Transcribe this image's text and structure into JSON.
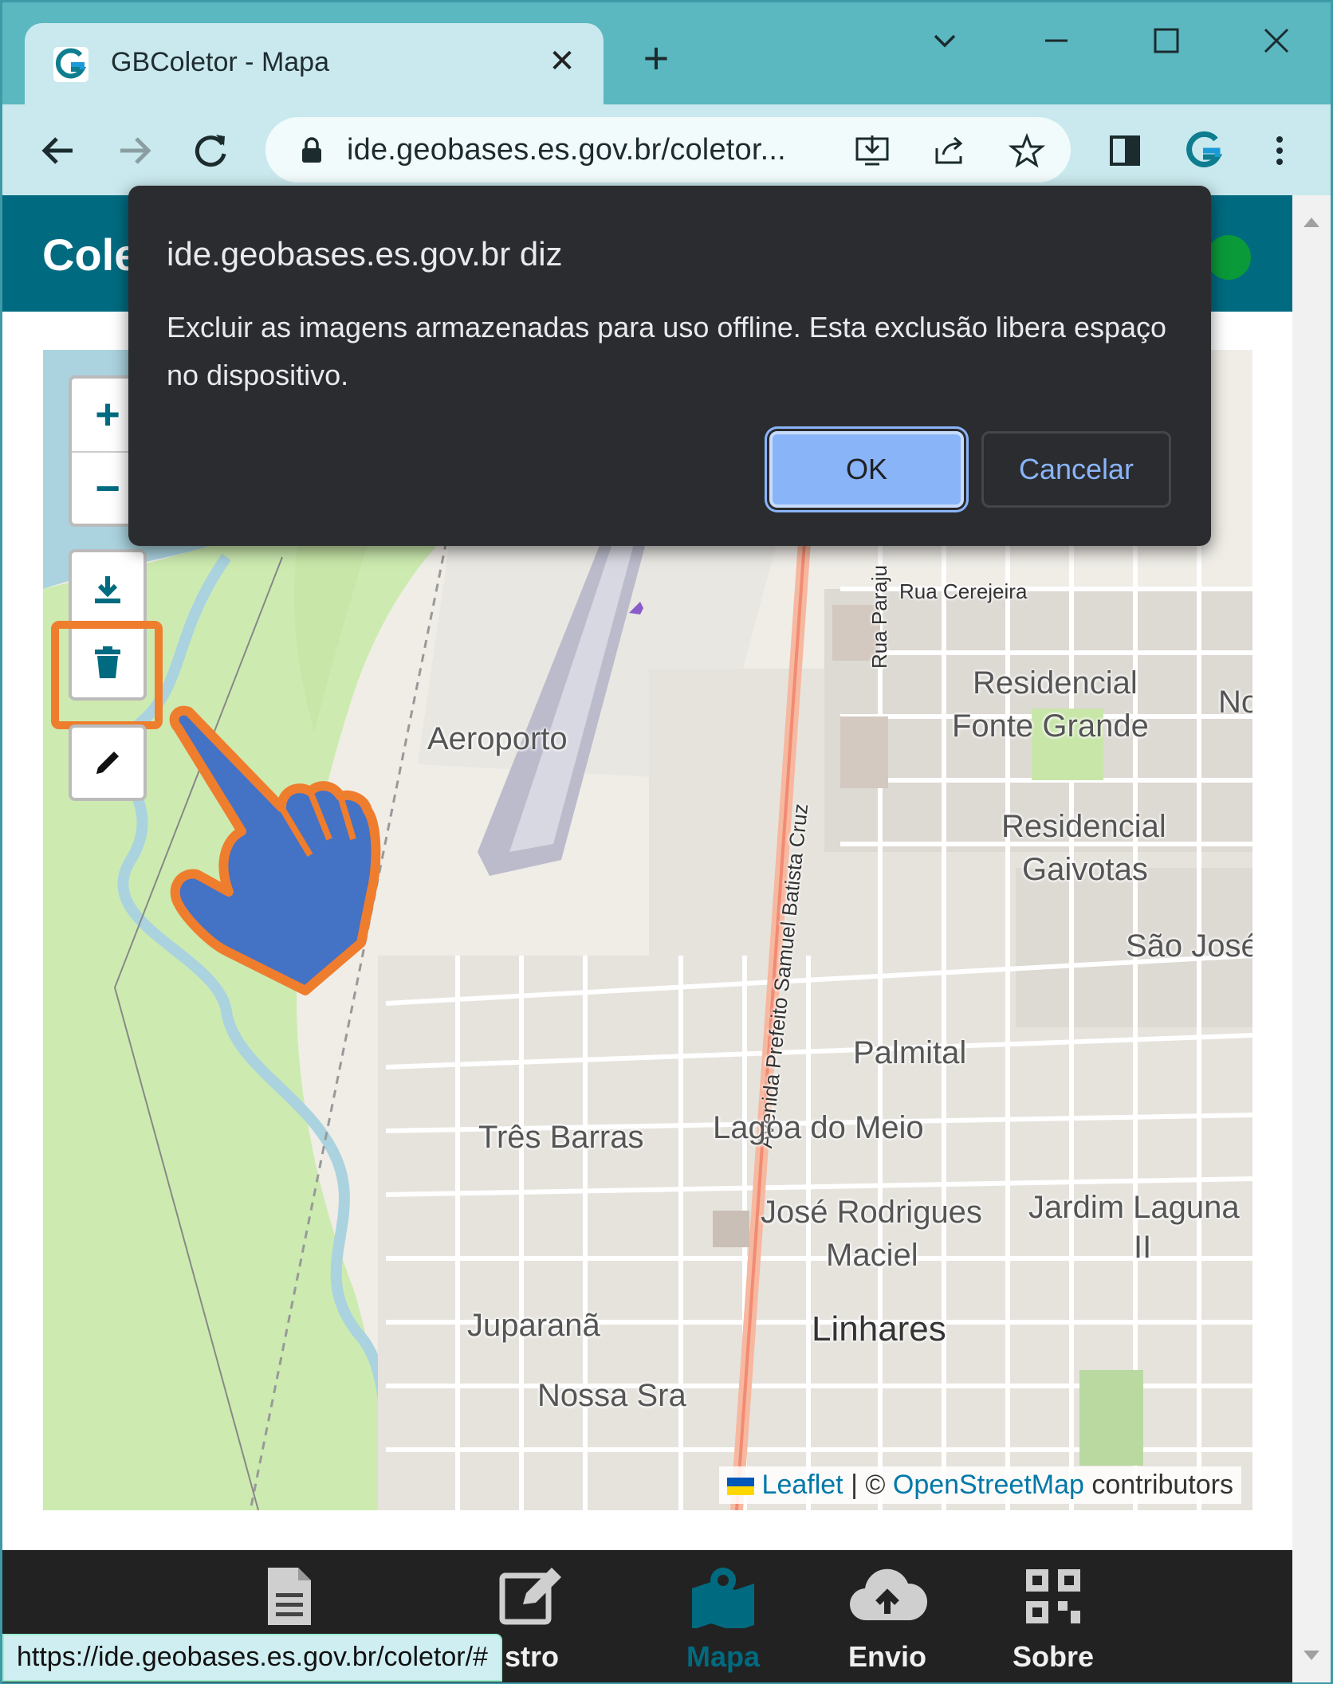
{
  "browser": {
    "tab_title": "GBColetor - Mapa",
    "tab_close": "✕",
    "new_tab": "+",
    "url": "ide.geobases.es.gov.br/coletor...",
    "status_url": "https://ide.geobases.es.gov.br/coletor/#"
  },
  "app": {
    "title": "Cole",
    "status_color": "#0a9a3a",
    "brand_color": "#006b80"
  },
  "map": {
    "zoom_in": "+",
    "zoom_out": "−",
    "labels": {
      "aeroporto": "Aeroporto",
      "rua_cerejeira": "Rua Cerejeira",
      "rua_paraju": "Rua Paraju",
      "residencial_fonte_grande_1": "Residencial",
      "residencial_fonte_grande_2": "Fonte Grande",
      "residencial_gaivotas_1": "Residencial",
      "residencial_gaivotas_2": "Gaivotas",
      "sao_jose": "São José",
      "avenida": "Avenida Prefeito Samuel Batista Cruz",
      "palmital": "Palmital",
      "tres_barras": "Três Barras",
      "lagoa_do_meio": "Lagoa do Meio",
      "jose_rodrigues_1": "José Rodrigues",
      "jose_rodrigues_2": "Maciel",
      "jardim_laguna_1": "Jardim Laguna",
      "jardim_laguna_2": "II",
      "juparana": "Juparanã",
      "linhares": "Linhares",
      "nossa_sra": "Nossa Sra",
      "no": "No"
    },
    "attribution": {
      "leaflet": "Leaflet",
      "sep": " | © ",
      "osm": "OpenStreetMap",
      "contributors": " contributors"
    }
  },
  "dialog": {
    "title": "ide.geobases.es.gov.br diz",
    "message": "Excluir as imagens armazenadas para uso offline. Esta exclusão libera espaço no dispositivo.",
    "ok_label": "OK",
    "cancel_label": "Cancelar"
  },
  "bottom_nav": {
    "items": [
      {
        "label": "",
        "icon": "document-icon"
      },
      {
        "label": "stro",
        "icon": "edit-icon"
      },
      {
        "label": "Mapa",
        "icon": "map-icon"
      },
      {
        "label": "Envio",
        "icon": "cloud-upload-icon"
      },
      {
        "label": "Sobre",
        "icon": "qr-code-icon"
      }
    ]
  }
}
